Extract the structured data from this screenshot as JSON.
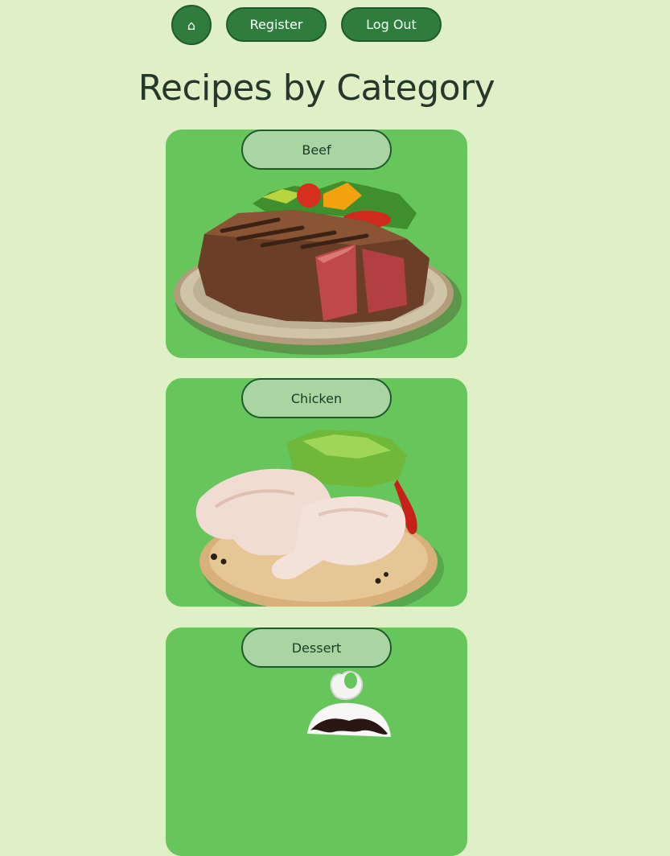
{
  "nav": {
    "home_label": "⌂",
    "register_label": "Register",
    "logout_label": "Log Out"
  },
  "page": {
    "title": "Recipes by Category"
  },
  "categories": [
    {
      "label": "Beef",
      "image": "grilled-steak-plate"
    },
    {
      "label": "Chicken",
      "image": "raw-chicken-legs-board"
    },
    {
      "label": "Dessert",
      "image": "ice-cream-sundae"
    }
  ],
  "colors": {
    "background": "#dfefc6",
    "nav_button": "#2e7d3c",
    "card": "#66c65c",
    "card_label": "#a8d5a2",
    "title": "#25382b"
  }
}
